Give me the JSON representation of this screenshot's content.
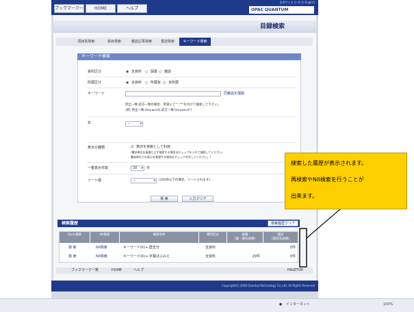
{
  "nav": {
    "bookmarks": "ブックマーク一覧",
    "home": "HOME",
    "help": "ヘルプ"
  },
  "logo": {
    "text": "OPAC  QUANTUM Technology",
    "links": "文字サイズ 小 中 大 English"
  },
  "page_title": "目録検索",
  "tabs": [
    "項目別検索",
    "資目検索",
    "雑誌記事検索",
    "書誌検索",
    "キーワード検索"
  ],
  "form": {
    "title": "キーワード検索",
    "rows": {
      "target_label": "資料区分",
      "target_options": [
        "全資料",
        "図書",
        "雑誌"
      ],
      "holding_label": "所蔵区分",
      "holding_options": [
        "全資料",
        "所蔵有",
        "未所蔵"
      ],
      "keyword_label": "キーワード",
      "synonym_link": "同義語を展開",
      "hint1": "完全一致,前方一致の場合、単語にて\"\",\"*\"を付けて検索して下さい。",
      "hint2": "(例) 完全一致:[keyword],前方一致:[keyword*]",
      "year_label": "年",
      "year_value": "--",
      "display_label": "表示の種類",
      "display_option": "表示を検索として利用",
      "display_note1": "(書誌単位を基礎とせず検索する場合はチェックを入れて検索してください。",
      "display_note2": "書誌単位での表示を希望する場合はチェックを外してください。)",
      "perpage_label": "一覧表示件数",
      "perpage_value": "20",
      "perpage_unit": "件",
      "sort_label": "ソート順",
      "sort_value": "--",
      "sort_note": "(200件以下の場合、ソートされます)"
    },
    "search_button": "検 索",
    "clear_button": "入力クリア"
  },
  "history": {
    "title": "検索履歴",
    "clear_button": "検索履歴クリア",
    "columns": [
      "Opac検索",
      "NII検索",
      "検索条件",
      "資料区分",
      "図書\n(図・書名表題)",
      "雑誌\n(雑誌名表題)"
    ],
    "rows": [
      {
        "opac": "検 索",
        "nii": "NII検索",
        "condition": "キーワード(K)+:歴史分",
        "type": "全資料",
        "books": "",
        "journals": "0件"
      },
      {
        "opac": "検 索",
        "nii": "NII検索",
        "condition": "キーワード(K)+:字幕ぱぶみえ",
        "type": "全資料",
        "books": "29件",
        "journals": "0件"
      }
    ]
  },
  "bottom_nav": [
    "ブックマーク一覧",
    "HOME",
    "ヘルプ"
  ],
  "pagetop": "PAGETOP",
  "footer_text": "Copyright(C) 2009 QuantumTechnology Co.,Ltd. All Rights Reserved",
  "status": {
    "zone": "インターネット",
    "zoom": "100%"
  },
  "callout": {
    "line1": "検索した履歴が表示されます。",
    "line2": "再検索やNII検索を行うことが",
    "line3": "出来ます。"
  }
}
